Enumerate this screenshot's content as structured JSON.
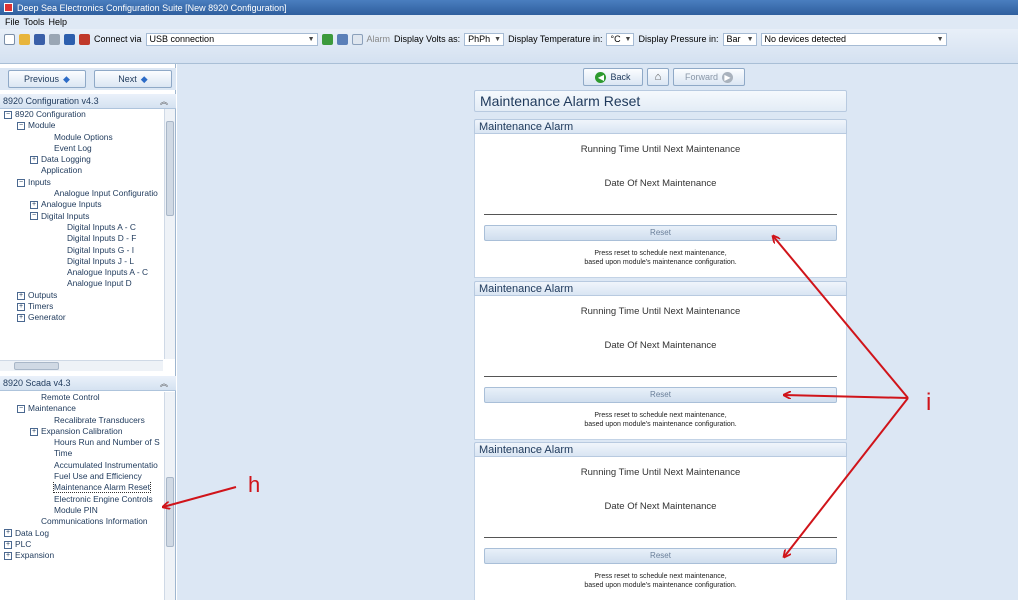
{
  "window": {
    "title": "Deep Sea Electronics Configuration Suite [New 8920 Configuration]"
  },
  "menu": [
    "File",
    "Tools",
    "Help"
  ],
  "toolbar": {
    "connect_label": "Connect via",
    "connect_value": "USB connection",
    "alarm_label": "Alarm",
    "volts_label": "Display Volts as:",
    "volts_value": "PhPh",
    "temp_label": "Display Temperature in:",
    "temp_value": "°C",
    "pressure_label": "Display Pressure in:",
    "pressure_value": "Bar",
    "devices_value": "No devices detected"
  },
  "nav": {
    "previous": "Previous",
    "next": "Next",
    "back": "Back",
    "forward": "Forward"
  },
  "config_tree": {
    "header": "8920 Configuration v4.3",
    "items": [
      {
        "label": "8920 Configuration",
        "level": 0,
        "toggle": "−"
      },
      {
        "label": "Module",
        "level": 1,
        "toggle": "−"
      },
      {
        "label": "Module Options",
        "level": 3,
        "toggle": ""
      },
      {
        "label": "Event Log",
        "level": 3,
        "toggle": ""
      },
      {
        "label": "Data Logging",
        "level": 2,
        "toggle": "+"
      },
      {
        "label": "Application",
        "level": 2,
        "toggle": ""
      },
      {
        "label": "Inputs",
        "level": 1,
        "toggle": "−"
      },
      {
        "label": "Analogue Input Configuratio",
        "level": 3,
        "toggle": ""
      },
      {
        "label": "Analogue Inputs",
        "level": 2,
        "toggle": "+"
      },
      {
        "label": "Digital Inputs",
        "level": 2,
        "toggle": "−"
      },
      {
        "label": "Digital Inputs A - C",
        "level": 4,
        "toggle": ""
      },
      {
        "label": "Digital Inputs D - F",
        "level": 4,
        "toggle": ""
      },
      {
        "label": "Digital Inputs G - I",
        "level": 4,
        "toggle": ""
      },
      {
        "label": "Digital Inputs J - L",
        "level": 4,
        "toggle": ""
      },
      {
        "label": "Analogue Inputs A - C",
        "level": 4,
        "toggle": ""
      },
      {
        "label": "Analogue Input D",
        "level": 4,
        "toggle": ""
      },
      {
        "label": "Outputs",
        "level": 1,
        "toggle": "+"
      },
      {
        "label": "Timers",
        "level": 1,
        "toggle": "+"
      },
      {
        "label": "Generator",
        "level": 1,
        "toggle": "+"
      }
    ]
  },
  "scada_tree": {
    "header": "8920 Scada v4.3",
    "items": [
      {
        "label": "Remote Control",
        "level": 2,
        "toggle": ""
      },
      {
        "label": "Maintenance",
        "level": 1,
        "toggle": "−"
      },
      {
        "label": "Recalibrate Transducers",
        "level": 3,
        "toggle": ""
      },
      {
        "label": "Expansion Calibration",
        "level": 2,
        "toggle": "+"
      },
      {
        "label": "Hours Run and Number of S",
        "level": 3,
        "toggle": ""
      },
      {
        "label": "Time",
        "level": 3,
        "toggle": ""
      },
      {
        "label": "Accumulated Instrumentatio",
        "level": 3,
        "toggle": ""
      },
      {
        "label": "Fuel Use and Efficiency",
        "level": 3,
        "toggle": ""
      },
      {
        "label": "Maintenance Alarm Reset",
        "level": 3,
        "toggle": "",
        "selected": true
      },
      {
        "label": "Electronic Engine Controls",
        "level": 3,
        "toggle": ""
      },
      {
        "label": "Module PIN",
        "level": 3,
        "toggle": ""
      },
      {
        "label": "Communications Information",
        "level": 2,
        "toggle": ""
      },
      {
        "label": "Data Log",
        "level": 0,
        "toggle": "+"
      },
      {
        "label": "PLC",
        "level": 0,
        "toggle": "+"
      },
      {
        "label": "Expansion",
        "level": 0,
        "toggle": "+"
      }
    ]
  },
  "main": {
    "title": "Maintenance Alarm Reset",
    "alarms": [
      {
        "header": "Maintenance Alarm",
        "running_time_label": "Running Time Until Next Maintenance",
        "date_label": "Date Of Next Maintenance",
        "reset_label": "Reset",
        "note_line1": "Press reset to schedule next maintenance,",
        "note_line2": "based upon module's maintenance configuration."
      },
      {
        "header": "Maintenance Alarm",
        "running_time_label": "Running Time Until Next Maintenance",
        "date_label": "Date Of Next Maintenance",
        "reset_label": "Reset",
        "note_line1": "Press reset to schedule next maintenance,",
        "note_line2": "based upon module's maintenance configuration."
      },
      {
        "header": "Maintenance Alarm",
        "running_time_label": "Running Time Until Next Maintenance",
        "date_label": "Date Of Next Maintenance",
        "reset_label": "Reset",
        "note_line1": "Press reset to schedule next maintenance,",
        "note_line2": "based upon module's maintenance configuration."
      }
    ]
  },
  "annotations": {
    "h": "h",
    "i": "i",
    "arrow_color": "#d0141a"
  }
}
